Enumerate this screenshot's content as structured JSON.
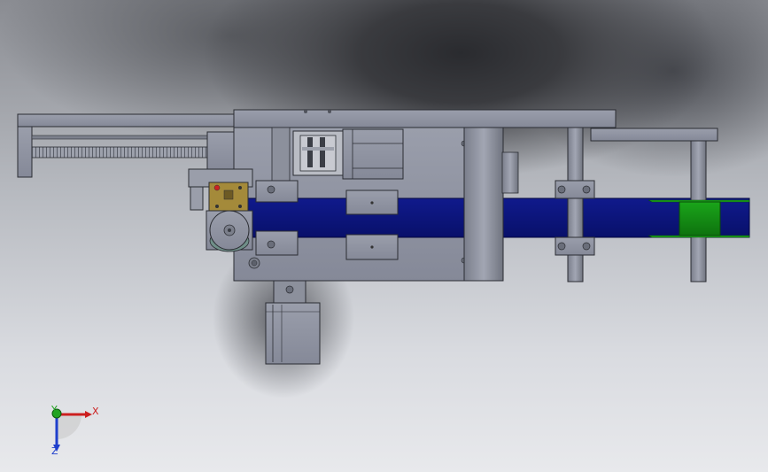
{
  "view": {
    "colors": {
      "metal": "#8f93a1",
      "metal_dark": "#6f7380",
      "edge": "#2b2d33",
      "belt": "#0d1580",
      "roller": "#128a12",
      "brass": "#a48a3a",
      "axis_x": "#cc1f1f",
      "axis_y": "#22a322",
      "axis_z": "#1f3fcc"
    }
  },
  "triad": {
    "x_label": "X",
    "y_label": "Y",
    "z_label": "Z"
  }
}
